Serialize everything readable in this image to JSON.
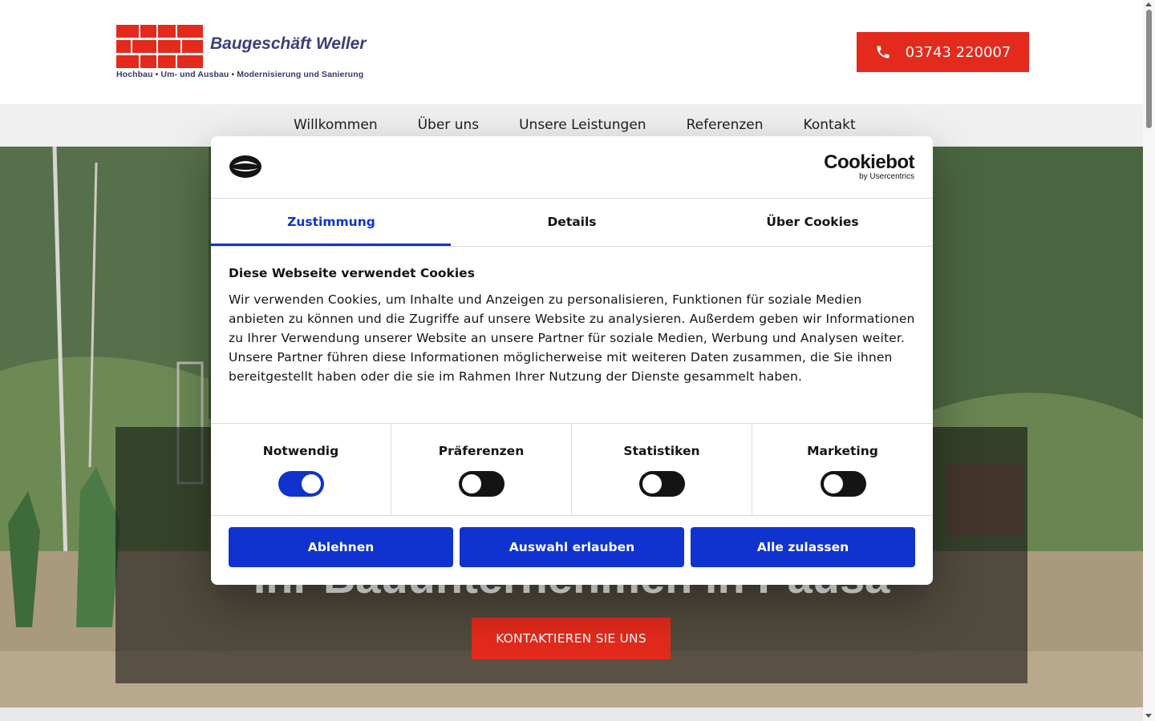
{
  "header": {
    "logo_name": "Baugeschäft Weller",
    "logo_tagline": "Hochbau • Um- und Ausbau • Modernisierung und Sanierung",
    "phone": "03743 220007",
    "brand_color": "#e32a1c"
  },
  "nav": {
    "items": [
      {
        "label": "Willkommen"
      },
      {
        "label": "Über uns"
      },
      {
        "label": "Unsere Leistungen"
      },
      {
        "label": "Referenzen"
      },
      {
        "label": "Kontakt"
      }
    ]
  },
  "hero": {
    "heading": "Ihr Bauunternehmen in Pausa",
    "cta_label": "KONTAKTIEREN SIE UNS"
  },
  "cookie": {
    "brand": "Cookiebot",
    "brand_sub": "by Usercentrics",
    "tabs": [
      {
        "label": "Zustimmung",
        "active": true
      },
      {
        "label": "Details",
        "active": false
      },
      {
        "label": "Über Cookies",
        "active": false
      }
    ],
    "title": "Diese Webseite verwendet Cookies",
    "text": "Wir verwenden Cookies, um Inhalte und Anzeigen zu personalisieren, Funktionen für soziale Medien anbieten zu können und die Zugriffe auf unsere Website zu analysieren. Außerdem geben wir Informationen zu Ihrer Verwendung unserer Website an unsere Partner für soziale Medien, Werbung und Analysen weiter. Unsere Partner führen diese Informationen möglicherweise mit weiteren Daten zusammen, die Sie ihnen bereitgestellt haben oder die sie im Rahmen Ihrer Nutzung der Dienste gesammelt haben.",
    "categories": [
      {
        "label": "Notwendig",
        "enabled": true
      },
      {
        "label": "Präferenzen",
        "enabled": false
      },
      {
        "label": "Statistiken",
        "enabled": false
      },
      {
        "label": "Marketing",
        "enabled": false
      }
    ],
    "buttons": {
      "decline": "Ablehnen",
      "allow_selection": "Auswahl erlauben",
      "allow_all": "Alle zulassen"
    },
    "accent_color": "#1032cf"
  }
}
